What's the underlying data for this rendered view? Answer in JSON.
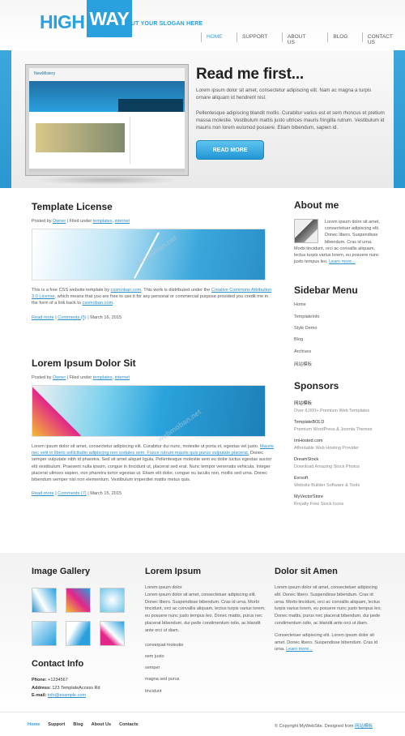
{
  "logo": {
    "high": "HIGH",
    "way": "WAY",
    "slogan": "PUT YOUR SLOGAN HERE"
  },
  "nav": [
    "HOME",
    "SUPPORT",
    "ABOUT US",
    "BLOG",
    "CONTACT US"
  ],
  "hero": {
    "title": "Read me first...",
    "p1": "Lorem ipsum dolor sit amet, consectetur adipiscing elit. Nam ac magna a turpis ornare aliquam id hendrerit nisl.",
    "p2": "Pellentesque adipiscing blandit mollis. Curabitur varius est et sem rhoncus et pretium massa molestie. Vestibulum mattis justo ultrices mauris fringilla rutrum. Vestibulum id mauris non lorem euismod posuere. Etiam bibendum, sapien id.",
    "button": "READ MORE",
    "screen": {
      "brand": "NewMistery"
    }
  },
  "posts": [
    {
      "title": "Template License",
      "meta_pre": "Posted by",
      "author": "Owner",
      "meta_mid": "| Filed under",
      "cat1": "templates",
      "cat2": "internet",
      "text_a": "This is a free CSS website template by",
      "link_a": "cssmoban.com",
      "text_b": ". This work is distributed under the",
      "link_b": "Creative Commons Attribution 3.0 License",
      "text_c": ", which means that you are free to use it for any personal or commercial purpose provided you credit me in the form of a link back to",
      "link_c": "cssmoban.com",
      "read": "Read more",
      "comments": "Comments (5)",
      "date": "| March 16, 2015"
    },
    {
      "title": "Lorem Ipsum Dolor Sit",
      "meta_pre": "Posted by",
      "author": "Owner",
      "meta_mid": "| Filed under",
      "cat1": "templates",
      "cat2": "internet",
      "text_a": "Lorem ipsum dolor sit amet, consectetur adipiscing elit. Curabitur dui nunc, molestie ut porta et, egestas vel justo.",
      "link_a": "Mauris nec velit in libero sollicitudin adipiscing non sodales sem. Fusce rutrum mauris quis purus vulputate placerat.",
      "text_b": "Donec semper vulputate nibh id pharetra. Sed sit amet aliquet ligula. Pellentesque molestie sem eu dolor luctus egestas auctor elit vestibulum. Praesent nulla ipsum, congue in tincidunt ut, placerat sed erat. Nunc tempor venenatis vehicula. Integer placerat ultrices sapien, non pharetra tortor egestas ut. Etiam elit dolor, congue eu iaculis non, mollis sed urna. Donec bibendum semper nisl non elementum. Vestibulum imperdiet mattis metus quis.",
      "read": "Read more",
      "comments": "Comments (7)",
      "date": "| March 15, 2015"
    }
  ],
  "sidebar": {
    "about_title": "About me",
    "about_text": "Lorem ipsum dolor sit amet, consectetuer adipiscing elit. Donec libero. Suspendisse bibendum. Cras id urna. Morbi tincidunt, orci ac convallis aliquam, lectus turpis varius lorem, eu posuere nunc justo tempus leo.",
    "about_link": "Learn more...",
    "menu_title": "Sidebar Menu",
    "menu": [
      "Home",
      "TemplateInfo",
      "Style Demo",
      "Blog",
      "Archives",
      "网站模板"
    ],
    "sponsors_title": "Sponsors",
    "sponsors": [
      {
        "t": "网站模板",
        "d": "Over 6,000+ Premium Web Templates"
      },
      {
        "t": "TemplateBOLD",
        "d": "Premium WordPress & Joomla Themes"
      },
      {
        "t": "ImHosted.com",
        "d": "Affordable Web Hosting Provider"
      },
      {
        "t": "DreamStock",
        "d": "Download Amazing Stock Photos"
      },
      {
        "t": "Evrsoft",
        "d": "Website Builder Software & Tools"
      },
      {
        "t": "MyVectorStore",
        "d": "Royalty Free Stock Icons"
      }
    ]
  },
  "footer": {
    "gallery_title": "Image Gallery",
    "contact_title": "Contact Info",
    "phone_label": "Phone:",
    "phone": "+1234567",
    "address_label": "Address:",
    "address": "123 TemplateAccess Rd",
    "email_label": "E-mail:",
    "email": "info@example.com",
    "col2_title": "Lorem Ipsum",
    "col2_text": "Lorem ipsum dolor\nLorem ipsum dolor sit amet, consectetuer adipiscing elit. Donec libero. Suspendisse bibendum. Cras id urna. Morbi tincidunt, orci ac convallis aliquam, lectus turpis varius lorem, eu posuere nunc justo tempus leo. Donec mattis, purus nec placerat bibendum, dui pede condimentum odio, ac blandit ante orci ut diam.",
    "col2_links": [
      "consequat molestie",
      "sem justo",
      "semper",
      "magna sed purus",
      "tincidunt"
    ],
    "col3_title": "Dolor sit Amen",
    "col3_text": "Lorem ipsum dolor sit amet, consectetuer adipiscing elit. Donec libero. Suspendisse bibendum. Cras id urna. Morbi tincidunt, orci ac convallis aliquam, lectus turpis varius lorem, eu posuere nunc justo tempus leo. Donec mattis, purus nec placerat bibendum, dui pede condimentum odio, ac blandit ante orci ut diam.",
    "col3_text2": "Consectetuer adipiscing elit. Lorem ipsum dolor sit amet. Donec libero. Suspendisse bibendum. Cras id urna.",
    "col3_link": "Learn more...",
    "bottom_nav": [
      "Home",
      "Support",
      "Blog",
      "About Us",
      "Contacts"
    ],
    "copyright": "© Copyright MyWebSite. Designed from",
    "copy_link": "网站模板"
  },
  "watermark": "webmoban.net",
  "colors": {
    "accent": "#2aa0de",
    "text": "#444444"
  }
}
